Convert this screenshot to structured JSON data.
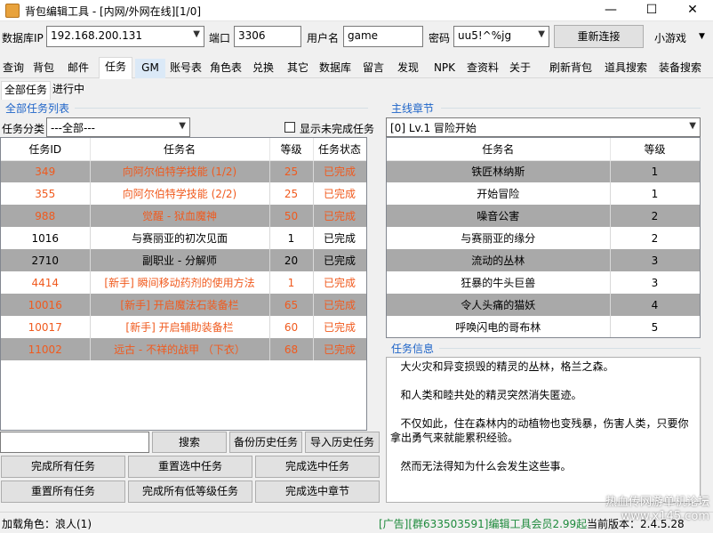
{
  "window": {
    "title": "背包编辑工具 - [内网/外网在线][1/0]",
    "minimize": "—",
    "maximize": "☐",
    "close": "✕"
  },
  "connection": {
    "db_ip_label": "数据库IP",
    "db_ip_value": "192.168.200.131",
    "port_label": "端口",
    "port_value": "3306",
    "user_label": "用户名",
    "user_value": "game",
    "password_label": "密码",
    "password_value": "uu5!^%jg",
    "reconnect_button": "重新连接",
    "mini_game_link": "小游戏"
  },
  "tabs": [
    "查询",
    "背包",
    "邮件",
    "任务",
    "GM",
    "账号表",
    "角色表",
    "兑换",
    "其它",
    "数据库",
    "留言",
    "发现",
    "NPK",
    "查资料",
    "关于"
  ],
  "active_tab": "任务",
  "right_links": [
    "刷新背包",
    "道具搜索",
    "装备搜索"
  ],
  "subtabs": [
    "全部任务",
    "进行中"
  ],
  "left_panel": {
    "group_title": "全部任务列表",
    "category_label": "任务分类",
    "category_value": "---全部---",
    "show_unfinished_label": "显示未完成任务",
    "columns": [
      "任务ID",
      "任务名",
      "等级",
      "任务状态"
    ],
    "rows": [
      {
        "id": "349",
        "name": "向阿尔伯特学技能 (1/2)",
        "level": "25",
        "status": "已完成",
        "alt": true,
        "done": true
      },
      {
        "id": "355",
        "name": "向阿尔伯特学技能 (2/2)",
        "level": "25",
        "status": "已完成",
        "alt": false,
        "done": true
      },
      {
        "id": "988",
        "name": "觉醒 - 狱血魔神",
        "level": "50",
        "status": "已完成",
        "alt": true,
        "done": true
      },
      {
        "id": "1016",
        "name": "与赛丽亚的初次见面",
        "level": "1",
        "status": "已完成",
        "alt": false,
        "done": false
      },
      {
        "id": "2710",
        "name": "副职业 - 分解师",
        "level": "20",
        "status": "已完成",
        "alt": true,
        "done": false
      },
      {
        "id": "4414",
        "name": "[新手] 瞬间移动药剂的使用方法",
        "level": "1",
        "status": "已完成",
        "alt": false,
        "done": true
      },
      {
        "id": "10016",
        "name": "[新手] 开启魔法石装备栏",
        "level": "65",
        "status": "已完成",
        "alt": true,
        "done": true
      },
      {
        "id": "10017",
        "name": "[新手] 开启辅助装备栏",
        "level": "60",
        "status": "已完成",
        "alt": false,
        "done": true
      },
      {
        "id": "11002",
        "name": "远古 - 不祥的战甲 （下衣）",
        "level": "68",
        "status": "已完成",
        "alt": true,
        "done": true
      }
    ],
    "search_placeholder": "",
    "search_button": "搜索",
    "backup_button": "备份历史任务",
    "import_button": "导入历史任务",
    "complete_all": "完成所有任务",
    "reset_selected": "重置选中任务",
    "complete_selected": "完成选中任务",
    "reset_all": "重置所有任务",
    "complete_low_level": "完成所有低等级任务",
    "complete_chapter": "完成选中章节"
  },
  "right_panel": {
    "group_title": "主线章节",
    "chapter_value": "[0] Lv.1 冒险开始",
    "columns": [
      "任务名",
      "等级"
    ],
    "rows": [
      {
        "name": "铁匠林纳斯",
        "level": "1",
        "alt": true
      },
      {
        "name": "开始冒险",
        "level": "1",
        "alt": false
      },
      {
        "name": "噪音公害",
        "level": "2",
        "alt": true
      },
      {
        "name": "与赛丽亚的缘分",
        "level": "2",
        "alt": false
      },
      {
        "name": "流动的丛林",
        "level": "3",
        "alt": true
      },
      {
        "name": "狂暴的牛头巨兽",
        "level": "3",
        "alt": false
      },
      {
        "name": "令人头痛的猫妖",
        "level": "4",
        "alt": true
      },
      {
        "name": "呼唤闪电的哥布林",
        "level": "5",
        "alt": false
      }
    ],
    "info_title": "任务信息",
    "info_paragraphs": [
      "   大火灾和异变损毁的精灵的丛林，格兰之森。",
      "   和人类和睦共处的精灵突然消失匿迹。",
      "   不仅如此，住在森林内的动植物也变残暴，伤害人类，只要你拿出勇气来就能累积经验。",
      "   然而无法得知为什么会发生这些事。"
    ]
  },
  "status": {
    "loaded_role": "加载角色：浪人(1)",
    "ad_text": "[广告][群633503591]编辑工具会员2.99起",
    "version": "当前版本：2.4.5.28",
    "watermark": "热血传网游单机论坛\nwww.x145.com"
  },
  "colors": {
    "done_text": "#f05a1e",
    "alt_row": "#a9a9a9",
    "group_title": "#1e64c8",
    "ad_text": "#1e8a3c"
  }
}
